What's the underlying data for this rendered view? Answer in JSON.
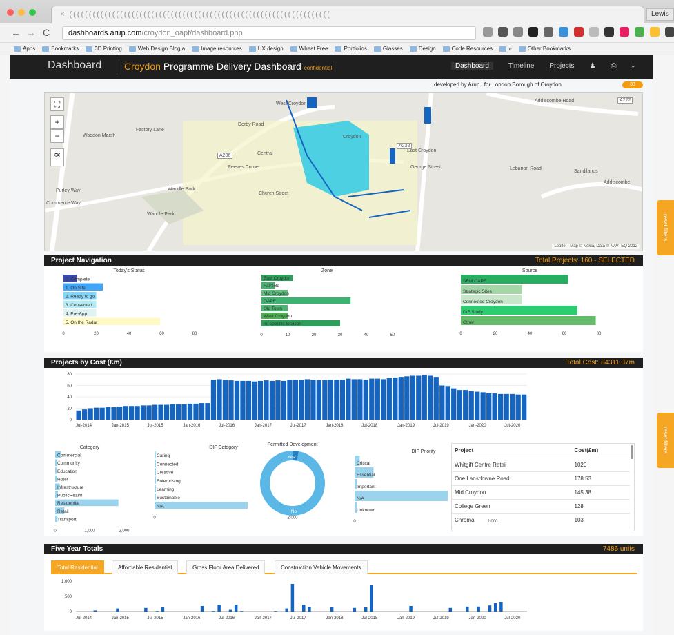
{
  "browser": {
    "tab_title": "× (((((((((((((((((((((((((((((((((((((((((((((((((((((((((((((((((((",
    "profile": "Lewis",
    "url_host": "dashboards.arup.com",
    "url_path": "/croydon_oapf/dashboard.php",
    "bookmarks": [
      "Apps",
      "Bookmarks",
      "3D Printing",
      "Web Design Blog a",
      "Image resources",
      "UX design",
      "Wheat Free",
      "Portfolios",
      "Glasses",
      "Design",
      "Code Resources",
      "»",
      "Other Bookmarks"
    ]
  },
  "app": {
    "title": "Dashboard",
    "subtitle_orange": "Croydon",
    "subtitle": "Programme Delivery Dashboard",
    "confidential": "confidential",
    "nav": [
      "Dashboard",
      "Timeline",
      "Projects"
    ],
    "credit": "developed by Arup | for London Borough of Croydon",
    "badge": "33"
  },
  "map": {
    "labels": [
      "West Croydon",
      "Croydon",
      "Waddon Marsh",
      "Reeves Corner",
      "Central",
      "Church Street",
      "Wandle Park",
      "Wandle Park",
      "Lebanon Road",
      "Sandilands",
      "Addiscombe Road",
      "Addiscombe",
      "Purley Way",
      "George Street",
      "East Croydon",
      "Derby Road",
      "Factory Lane",
      "Commerce Way"
    ],
    "road_codes": [
      "A236",
      "A232",
      "A222"
    ],
    "attribution": "Leaflet | Map © Nokia, Data © NAVTEQ 2012"
  },
  "project_navigation": {
    "header": "Project Navigation",
    "total": "Total Projects: 160 - SELECTED",
    "status": {
      "title": "Today's Status",
      "items": [
        "0. Complete",
        "1. On Site",
        "2. Ready to go",
        "3. Consented",
        "4. Pre-App",
        "5. On the Radar"
      ],
      "values": [
        8,
        24,
        20,
        20,
        20,
        59
      ],
      "colors": [
        "#3949ab",
        "#42a5f5",
        "#81d4fa",
        "#b2ebf2",
        "#e0f2f1",
        "#fff9c4"
      ],
      "ticks": [
        "0",
        "20",
        "40",
        "60",
        "80"
      ],
      "max": 80
    },
    "zone": {
      "title": "Zone",
      "items": [
        "East Croydon",
        "Fairfield",
        "Mid Croydon",
        "OAPF",
        "Old Town",
        "West Croydon",
        "no specific location"
      ],
      "values": [
        12,
        5,
        10,
        34,
        10,
        10,
        30
      ],
      "ticks": [
        "0",
        "10",
        "20",
        "30",
        "40",
        "50"
      ],
      "max": 50
    },
    "source": {
      "title": "Source",
      "items": [
        "SRM OAPF",
        "Strategic Sites",
        "Connected Croydon",
        "DIF Study",
        "Other"
      ],
      "values": [
        70,
        40,
        40,
        76,
        88
      ],
      "ticks": [
        "0",
        "20",
        "40",
        "60",
        "80"
      ],
      "max": 90
    }
  },
  "projects_by_cost": {
    "header": "Projects by Cost (£m)",
    "total": "Total Cost: £4311.37m",
    "ymax": 80,
    "yticks": [
      "80",
      "60",
      "40",
      "20",
      "0"
    ],
    "xticks": [
      "Jul-2014",
      "Jan-2015",
      "Jul-2015",
      "Jan-2016",
      "Jul-2016",
      "Jan-2017",
      "Jul-2017",
      "Jan-2018",
      "Jul-2018",
      "Jan-2019",
      "Jul-2019",
      "Jan-2020",
      "Jul-2020"
    ],
    "values": [
      16,
      18,
      20,
      21,
      21,
      22,
      22,
      23,
      24,
      24,
      24,
      25,
      25,
      26,
      26,
      26,
      27,
      27,
      27,
      28,
      28,
      29,
      29,
      70,
      71,
      70,
      69,
      68,
      68,
      68,
      67,
      68,
      69,
      68,
      69,
      68,
      70,
      70,
      70,
      71,
      70,
      69,
      70,
      70,
      70,
      70,
      72,
      71,
      71,
      70,
      72,
      72,
      71,
      73,
      74,
      75,
      76,
      77,
      77,
      78,
      77,
      75,
      60,
      59,
      55,
      52,
      52,
      50,
      49,
      48,
      47,
      46,
      45,
      45,
      45,
      44,
      44
    ],
    "category": {
      "title": "Category",
      "items": [
        "Commercial",
        "Community",
        "Education",
        "Hotel",
        "Infrastructure",
        "PublicRealm",
        "Residential",
        "Retail",
        "Transport"
      ],
      "values": [
        250,
        80,
        60,
        80,
        200,
        120,
        2750,
        400,
        100
      ],
      "ticks": [
        "0",
        "1,000",
        "2,000"
      ],
      "max": 3000
    },
    "dif_category": {
      "title": "DIF Category",
      "items": [
        "Caring",
        "Connected",
        "Creative",
        "Enterprising",
        "Learning",
        "Sustainable",
        "N/A"
      ],
      "values": [
        30,
        40,
        10,
        10,
        20,
        30,
        2700
      ],
      "ticks": [
        "0",
        "2,000"
      ],
      "max": 4000
    },
    "permitted": {
      "title": "Permitted Development",
      "yes": "Yes",
      "no": "No",
      "yes_share": 0.03
    },
    "dif_priority": {
      "title": "DIF Priority",
      "items": [
        "Critical",
        "Essential",
        "Important",
        "N/A",
        "Unknown"
      ],
      "values": [
        150,
        550,
        60,
        2700,
        60
      ],
      "ticks": [
        "0",
        "2,000"
      ],
      "max": 4000
    },
    "table": {
      "headers": [
        "Project",
        "Cost(£m)"
      ],
      "rows": [
        [
          "Whitgift Centre Retail",
          "1020"
        ],
        [
          "One Lansdowne Road",
          "178.53"
        ],
        [
          "Mid Croydon",
          "145.38"
        ],
        [
          "College Green",
          "128"
        ],
        [
          "Chroma",
          "103"
        ]
      ]
    }
  },
  "five_year": {
    "header": "Five Year Totals",
    "total": "7486 units",
    "tabs": [
      "Total Residential",
      "Affordable Residential",
      "Gross Floor Area Delivered",
      "Construction Vehicle Movements"
    ],
    "yticks": [
      "1,000",
      "500",
      "0"
    ],
    "ymax": 1100,
    "xticks": [
      "Jul-2014",
      "Jan-2015",
      "Jul-2015",
      "Jan-2016",
      "Jul-2016",
      "Jan-2017",
      "Jul-2017",
      "Jan-2018",
      "Jul-2018",
      "Jan-2019",
      "Jul-2019",
      "Jan-2020",
      "Jul-2020"
    ],
    "values": [
      0,
      0,
      0,
      40,
      0,
      0,
      0,
      110,
      0,
      0,
      0,
      0,
      130,
      0,
      20,
      150,
      0,
      0,
      0,
      0,
      0,
      0,
      200,
      0,
      20,
      250,
      0,
      60,
      250,
      20,
      0,
      0,
      0,
      0,
      0,
      20,
      0,
      110,
      1000,
      0,
      250,
      160,
      0,
      0,
      0,
      150,
      0,
      0,
      0,
      130,
      0,
      150,
      950,
      0,
      0,
      0,
      0,
      0,
      0,
      200,
      0,
      0,
      0,
      0,
      0,
      0,
      130,
      0,
      0,
      180,
      0,
      180,
      0,
      220,
      300,
      350,
      0,
      0,
      0,
      0
    ]
  },
  "reset_filters": "reset filters"
}
